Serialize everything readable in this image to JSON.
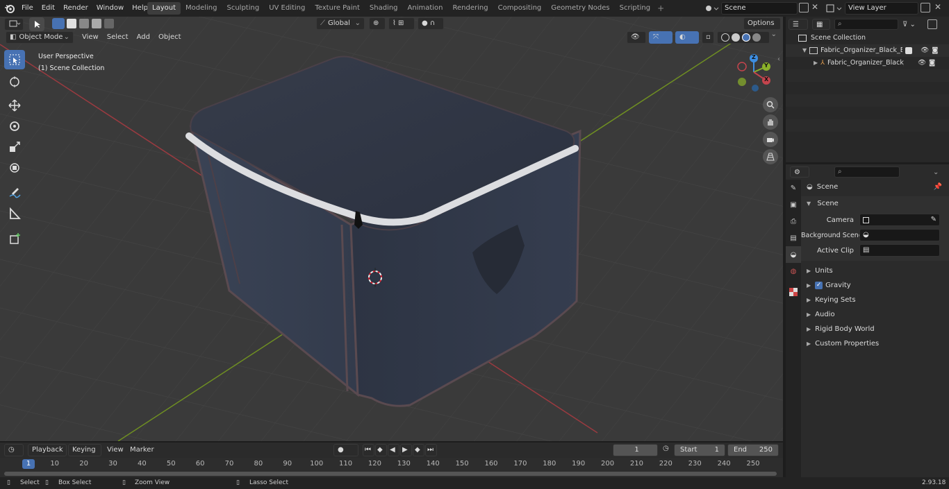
{
  "topbar": {
    "menus": [
      "File",
      "Edit",
      "Render",
      "Window",
      "Help"
    ],
    "workspaces": [
      "Layout",
      "Modeling",
      "Sculpting",
      "UV Editing",
      "Texture Paint",
      "Shading",
      "Animation",
      "Rendering",
      "Compositing",
      "Geometry Nodes",
      "Scripting"
    ],
    "active_workspace": "Layout",
    "scene": "Scene",
    "view_layer": "View Layer"
  },
  "viewport": {
    "mode": "Object Mode",
    "menus": [
      "View",
      "Select",
      "Add",
      "Object"
    ],
    "transform_orientation": "Global",
    "options_label": "Options",
    "overlay_line1": "User Perspective",
    "overlay_line2": "(1) Scene Collection",
    "gizmo_axes": [
      "Z",
      "Y",
      "X"
    ]
  },
  "outliner": {
    "root": "Scene Collection",
    "items": [
      {
        "label": "Fabric_Organizer_Black_Empt"
      },
      {
        "label": "Fabric_Organizer_Black_I"
      }
    ]
  },
  "properties": {
    "context_title": "Scene",
    "section": "Scene",
    "fields": [
      {
        "label": "Camera",
        "value": ""
      },
      {
        "label": "Background Scene",
        "value": ""
      },
      {
        "label": "Active Clip",
        "value": ""
      }
    ],
    "panels": [
      "Units",
      "Gravity",
      "Keying Sets",
      "Audio",
      "Rigid Body World",
      "Custom Properties"
    ],
    "gravity_checked": true
  },
  "timeline": {
    "menus": [
      "Playback",
      "Keying",
      "View",
      "Marker"
    ],
    "current_frame": "1",
    "start_label": "Start",
    "start": "1",
    "end_label": "End",
    "end": "250",
    "ticks": [
      "1",
      "10",
      "20",
      "30",
      "40",
      "50",
      "60",
      "70",
      "80",
      "90",
      "100",
      "110",
      "120",
      "130",
      "140",
      "150",
      "160",
      "170",
      "180",
      "190",
      "200",
      "210",
      "220",
      "230",
      "240",
      "250"
    ]
  },
  "statusbar": {
    "select": "Select",
    "box_select": "Box Select",
    "zoom_view": "Zoom View",
    "lasso_select": "Lasso Select",
    "version": "2.93.18"
  },
  "colors": {
    "accent": "#4772b3",
    "x_axis": "#c4444d",
    "y_axis": "#8bb22a",
    "z_axis": "#3d8ee2",
    "viewport_bg": "#3a3a3a"
  }
}
